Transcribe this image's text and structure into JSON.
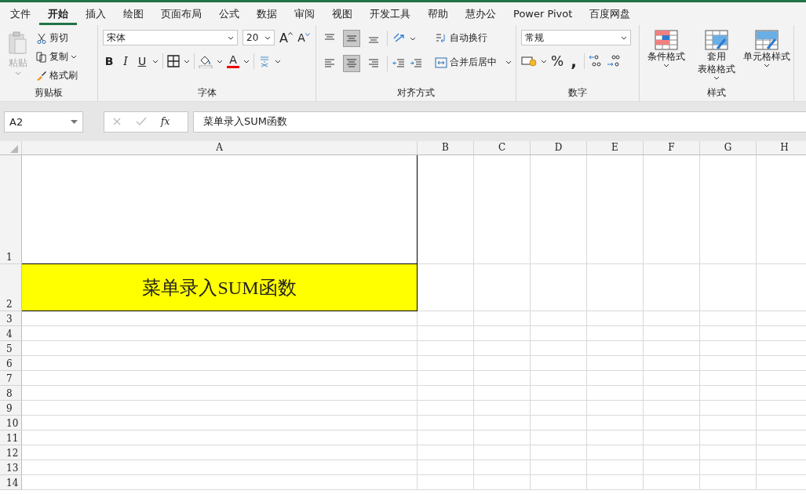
{
  "tabs": [
    {
      "label": "文件",
      "selected": false
    },
    {
      "label": "开始",
      "selected": true
    },
    {
      "label": "插入",
      "selected": false
    },
    {
      "label": "绘图",
      "selected": false
    },
    {
      "label": "页面布局",
      "selected": false
    },
    {
      "label": "公式",
      "selected": false
    },
    {
      "label": "数据",
      "selected": false
    },
    {
      "label": "审阅",
      "selected": false
    },
    {
      "label": "视图",
      "selected": false
    },
    {
      "label": "开发工具",
      "selected": false
    },
    {
      "label": "帮助",
      "selected": false
    },
    {
      "label": "慧办公",
      "selected": false
    },
    {
      "label": "Power Pivot",
      "selected": false
    },
    {
      "label": "百度网盘",
      "selected": false
    }
  ],
  "clipboard": {
    "label": "剪贴板",
    "paste": {
      "label": "粘贴",
      "disabled": true
    },
    "actions": [
      {
        "label": "剪切",
        "kind": "cut"
      },
      {
        "label": "复制",
        "kind": "copy"
      },
      {
        "label": "格式刷",
        "kind": "painter"
      }
    ]
  },
  "font": {
    "label": "字体",
    "name": "宋体",
    "size": "20",
    "grow": "A",
    "shrink": "A",
    "bold": "B",
    "italic": "I",
    "underline": "U",
    "font_color": "A"
  },
  "alignment": {
    "label": "对齐方式",
    "vertical": [
      {
        "selected": false
      },
      {
        "selected": true
      },
      {
        "selected": false
      }
    ],
    "horizontal": [
      {
        "selected": false
      },
      {
        "selected": true
      },
      {
        "selected": false
      }
    ],
    "wrap": "自动换行",
    "merge": "合并后居中"
  },
  "number": {
    "label": "数字",
    "format": "常规",
    "percent": "%",
    "comma": ","
  },
  "styles": {
    "label": "样式",
    "buttons": [
      {
        "lines": [
          "条件格式"
        ],
        "kind": "conditional"
      },
      {
        "lines": [
          "套用",
          "表格格式"
        ],
        "kind": "table"
      },
      {
        "lines": [
          "单元格样式"
        ],
        "kind": "cell"
      }
    ]
  },
  "name_box": "A2",
  "function_label": "fx",
  "formula": "菜单录入SUM函数",
  "grid": {
    "columns": [
      "A",
      "B",
      "C",
      "D",
      "E",
      "F",
      "G",
      "H"
    ],
    "rows": [
      {
        "header": "1",
        "cells": [
          {
            "bordered": true
          }
        ]
      },
      {
        "header": "2",
        "cells": [
          {
            "text": "菜单录入SUM函数",
            "color": "#ffff00",
            "bordered": true
          }
        ]
      },
      {
        "header": "3"
      },
      {
        "header": "4"
      },
      {
        "header": "5"
      },
      {
        "header": "6"
      },
      {
        "header": "7"
      },
      {
        "header": "8"
      },
      {
        "header": "9"
      },
      {
        "header": "10"
      },
      {
        "header": "11"
      },
      {
        "header": "12"
      },
      {
        "header": "13"
      },
      {
        "header": "14"
      }
    ]
  }
}
